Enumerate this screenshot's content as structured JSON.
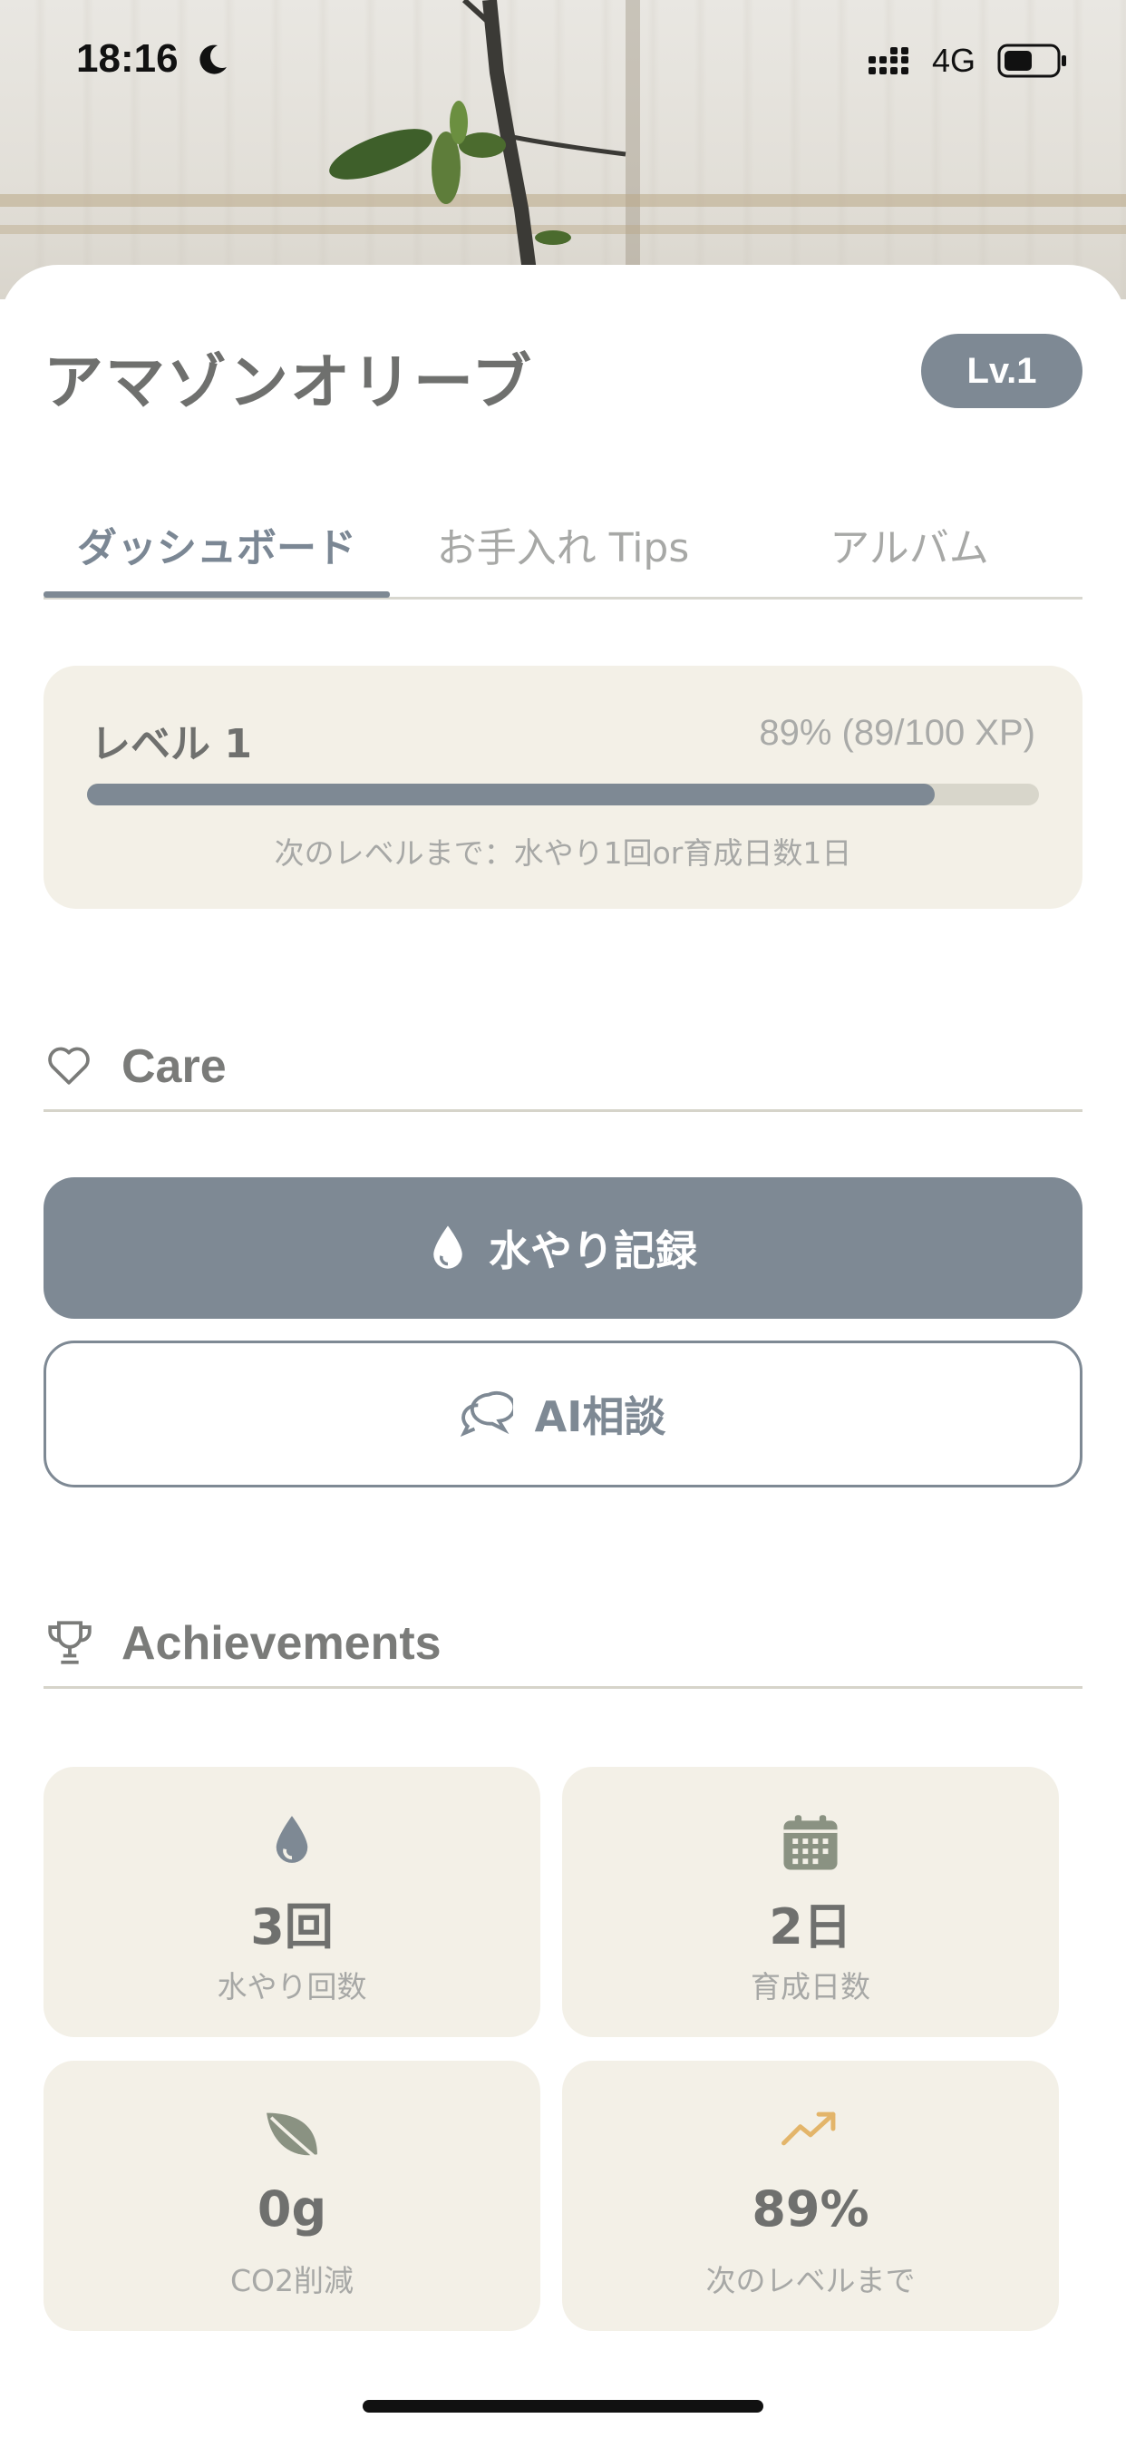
{
  "status_bar": {
    "time": "18:16",
    "network": "4G",
    "icons": [
      "moon-icon",
      "signal-icon",
      "battery-icon"
    ]
  },
  "plant": {
    "name": "アマゾンオリーブ",
    "level_badge": "Lv.1"
  },
  "tabs": [
    {
      "label": "ダッシュボード",
      "active": true
    },
    {
      "label": "お手入れ Tips",
      "active": false
    },
    {
      "label": "アルバム",
      "active": false
    }
  ],
  "level": {
    "title": "レベル 1",
    "progress_text": "89% (89/100 XP)",
    "progress_fraction": 0.89,
    "hint": "次のレベルまで：水やり1回or育成日数1日"
  },
  "care": {
    "heading": "Care",
    "icon": "heart-icon",
    "water_button": "水やり記録",
    "ai_button": "AI相談"
  },
  "achievements": {
    "heading": "Achievements",
    "icon": "trophy-icon",
    "items": [
      {
        "value": "3回",
        "caption": "水やり回数",
        "icon": "water-drop-icon"
      },
      {
        "value": "2日",
        "caption": "育成日数",
        "icon": "calendar-icon"
      },
      {
        "value": "0g",
        "caption": "CO2削減",
        "icon": "leaf-icon"
      },
      {
        "value": "89%",
        "caption": "次のレベルまで",
        "icon": "trending-up-icon"
      }
    ]
  },
  "colors": {
    "accent": "#7e8994",
    "card_bg": "#f3f0e7",
    "text_dark": "#6f706e",
    "text_muted": "#a7a8a6",
    "trend_icon": "#e3b56a"
  }
}
